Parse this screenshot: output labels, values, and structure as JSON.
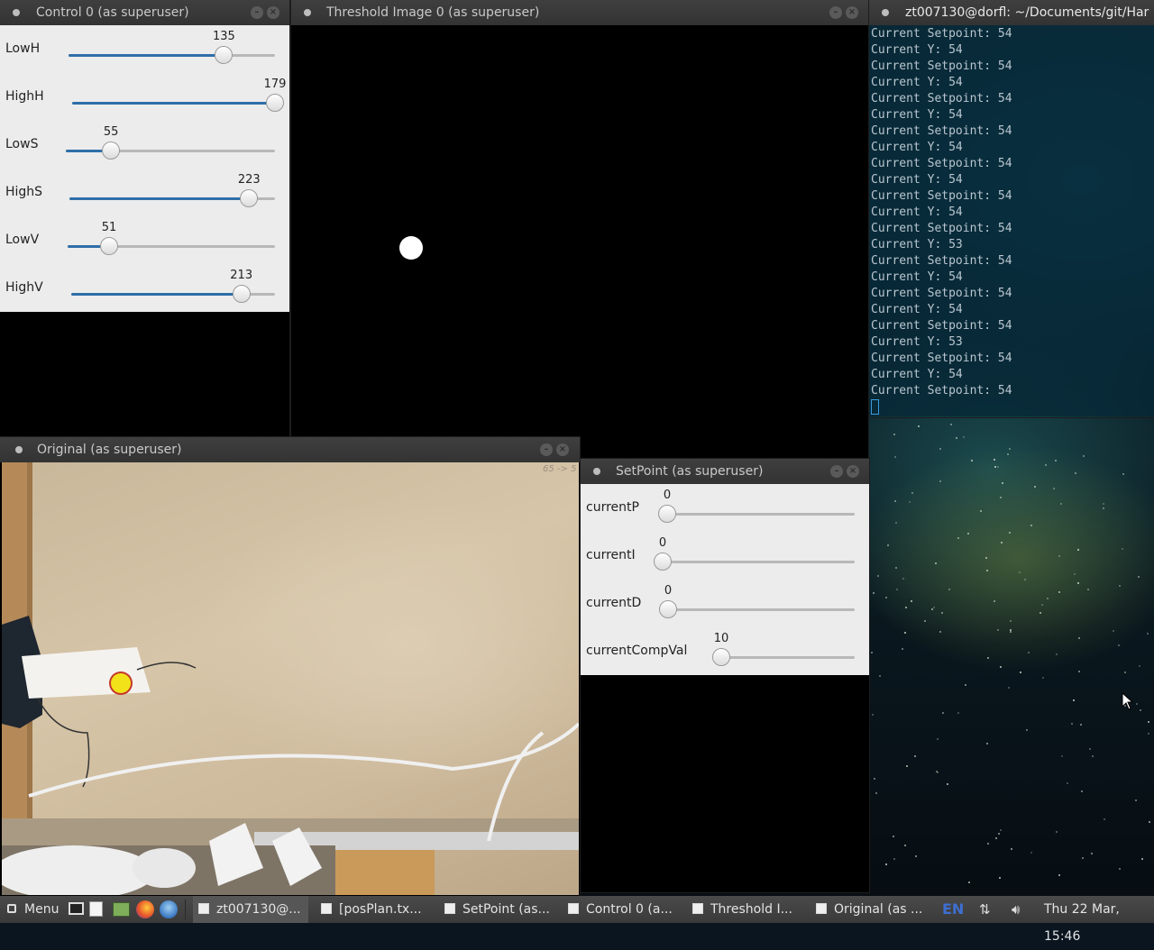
{
  "control_window": {
    "title": "Control 0 (as superuser)",
    "sliders": [
      {
        "label": "LowH",
        "value": "135",
        "fraction": 0.753
      },
      {
        "label": "HighH",
        "value": "179",
        "fraction": 1.0
      },
      {
        "label": "LowS",
        "value": "55",
        "fraction": 0.216
      },
      {
        "label": "HighS",
        "value": "223",
        "fraction": 0.874
      },
      {
        "label": "LowV",
        "value": "51",
        "fraction": 0.2
      },
      {
        "label": "HighV",
        "value": "213",
        "fraction": 0.835
      }
    ]
  },
  "threshold_window": {
    "title": "Threshold Image 0 (as superuser)"
  },
  "terminal_window": {
    "title": "zt007130@dorfl: ~/Documents/git/Har",
    "lines": [
      "Current Setpoint: 54",
      "Current Y: 54",
      "Current Setpoint: 54",
      "Current Y: 54",
      "Current Setpoint: 54",
      "Current Y: 54",
      "Current Setpoint: 54",
      "Current Y: 54",
      "Current Setpoint: 54",
      "Current Y: 54",
      "Current Setpoint: 54",
      "Current Y: 54",
      "Current Setpoint: 54",
      "Current Y: 53",
      "Current Setpoint: 54",
      "Current Y: 54",
      "Current Setpoint: 54",
      "Current Y: 54",
      "Current Setpoint: 54",
      "Current Y: 53",
      "Current Setpoint: 54",
      "Current Y: 54",
      "Current Setpoint: 54"
    ]
  },
  "original_window": {
    "title": "Original (as superuser)",
    "corner_note": "65 -> 5"
  },
  "setpoint_window": {
    "title": "SetPoint (as superuser)",
    "sliders": [
      {
        "label": "currentP",
        "value": "0",
        "fraction": 0.0
      },
      {
        "label": "currentI",
        "value": "0",
        "fraction": 0.0
      },
      {
        "label": "currentD",
        "value": "0",
        "fraction": 0.0
      },
      {
        "label": "currentCompVal",
        "value": "10",
        "fraction": 0.0
      }
    ]
  },
  "taskbar": {
    "menu_label": "Menu",
    "items": [
      "zt007130@...",
      "[posPlan.tx...",
      "SetPoint (as...",
      "Control 0 (a...",
      "Threshold I...",
      "Original (as ..."
    ],
    "language": "EN",
    "clock": "Thu 22 Mar, 15:46"
  },
  "colors": {
    "slider_fill": "#2f6ea8",
    "terminal_bg": "#062837",
    "lang_badge": "#3e6fd1",
    "tracked_ball": "#f2e21a"
  },
  "icons": [
    "window-menu-icon",
    "minimize-icon",
    "close-icon",
    "menu-icon",
    "terminal-launcher-icon",
    "text-editor-icon",
    "file-manager-icon",
    "firefox-icon",
    "thunderbird-icon",
    "network-icon",
    "volume-icon",
    "mouse-pointer-icon"
  ]
}
